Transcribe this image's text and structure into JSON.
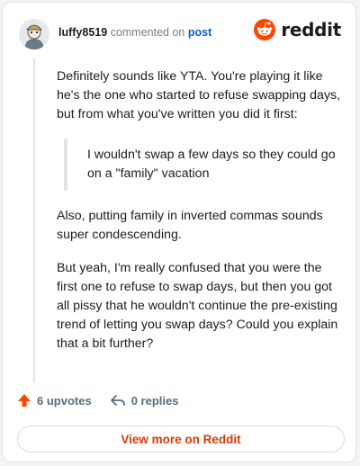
{
  "header": {
    "username": "luffy8519",
    "commented_on": "commented on",
    "post_link": "post",
    "brand": "reddit"
  },
  "comment": {
    "paragraph_1": "Definitely sounds like YTA. You're playing it like he's the one who started to refuse swapping days, but from what you've written you did it first:",
    "quote": "I wouldn't swap a few days so they could go on a \"family\" vacation",
    "paragraph_2": "Also, putting family in inverted commas sounds super condescending.",
    "paragraph_3": "But yeah, I'm really confused that you were the first one to refuse to swap days, but then you got all pissy that he wouldn't continue the pre-existing trend of letting you swap days? Could you explain that a bit further?"
  },
  "footer": {
    "upvotes": "6 upvotes",
    "replies": "0 replies",
    "view_more": "View more on Reddit"
  },
  "colors": {
    "brand": "#ff4500",
    "link": "#0b57d0",
    "view_more": "#d93a00"
  },
  "icons": [
    "avatar",
    "reddit-logo-icon",
    "upvote-arrow-icon",
    "reply-arrow-icon"
  ]
}
